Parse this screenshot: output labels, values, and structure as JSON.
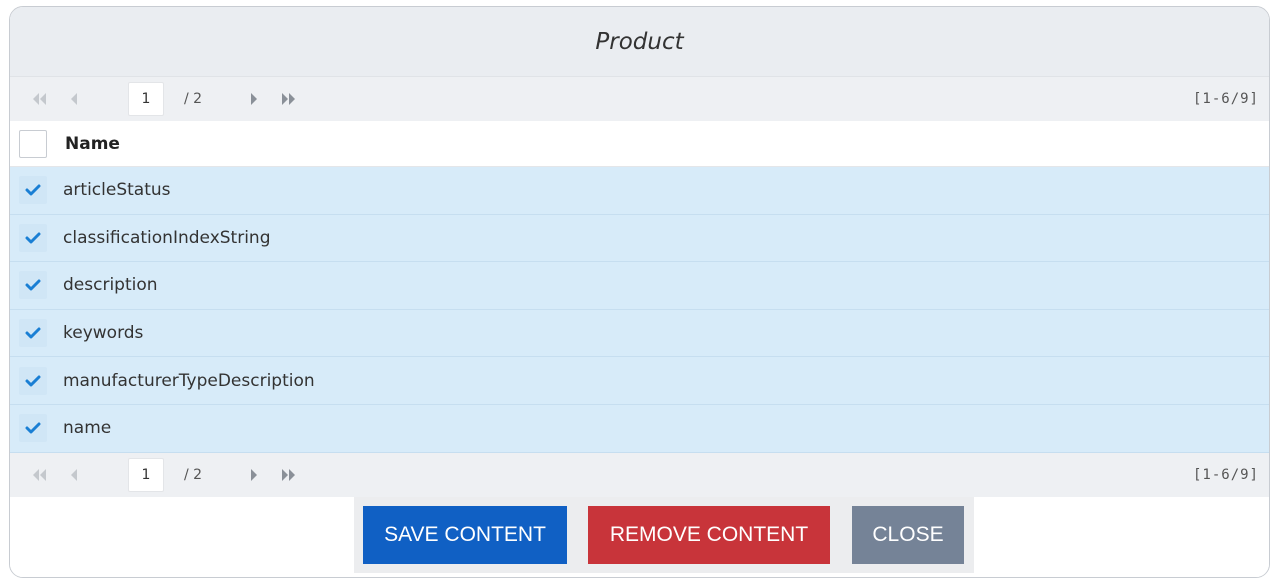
{
  "dialog": {
    "title": "Product"
  },
  "pager": {
    "current_page": "1",
    "total_pages": "/ 2",
    "range": "[1-6/9]"
  },
  "table": {
    "column_header": "Name",
    "rows": [
      {
        "label": "articleStatus",
        "checked": true
      },
      {
        "label": "classificationIndexString",
        "checked": true
      },
      {
        "label": "description",
        "checked": true
      },
      {
        "label": "keywords",
        "checked": true
      },
      {
        "label": "manufacturerTypeDescription",
        "checked": true
      },
      {
        "label": "name",
        "checked": true
      }
    ]
  },
  "buttons": {
    "save": "SAVE CONTENT",
    "remove": "REMOVE CONTENT",
    "close": "CLOSE"
  },
  "colors": {
    "save": "#1060c4",
    "remove": "#c8343a",
    "close": "#758397",
    "selected_row": "#d7ebf9",
    "check": "#1a7fd4"
  },
  "icons": {
    "first": "first-page-icon",
    "prev": "previous-page-icon",
    "next": "next-page-icon",
    "last": "last-page-icon",
    "check": "checkmark-icon"
  }
}
